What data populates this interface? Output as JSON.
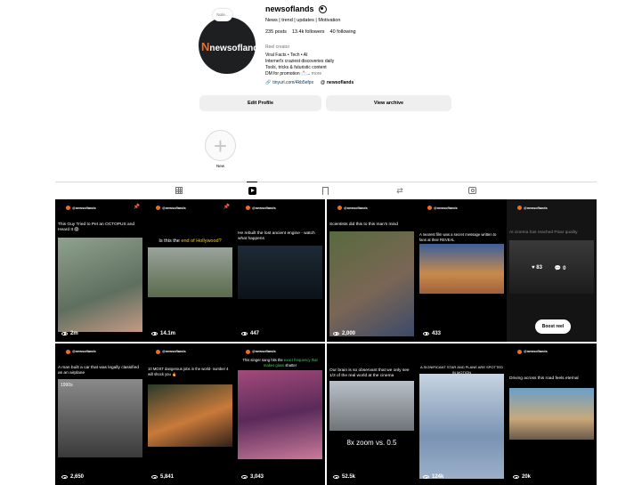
{
  "profile": {
    "note": "Note...",
    "username": "newsoflands",
    "avatar_logo": "newsoflands",
    "avatar_logo_letter": "N",
    "category_line": "News | trend | updates | Motivation",
    "posts": "235 posts",
    "followers": "13.4k followers",
    "following": "40 following",
    "role": "Reel creator",
    "bio_lines": [
      "Viral Facts • Tech • AI",
      "Internet's craziest discoveries daily",
      "Tools, tricks & futuristic content"
    ],
    "bio_last": "DM for promotion 📩...",
    "more": "more",
    "link": "tinyurl.com/4kb5efpx",
    "threads": "newsoflands"
  },
  "buttons": {
    "edit_profile": "Edit Profile",
    "view_archive": "View archive"
  },
  "highlight": {
    "label": "New"
  },
  "tabs": [
    "posts-grid",
    "reels",
    "saved",
    "reposts",
    "tagged"
  ],
  "reel_brand": "@newsoflands",
  "reels": [
    {
      "caption": "This Guy Tried to Pet an OCTOPUS and Heard It 😱",
      "views": "2m",
      "pinned": true
    },
    {
      "caption_pre": "Is this the ",
      "caption_hl": "end of Hollywood?",
      "views": "14.1m",
      "pinned": true
    },
    {
      "caption": "He rebuilt the lost ancient engine - watch what happens",
      "views": "447"
    },
    {
      "caption": "Scientists did this to this man's mind",
      "views": "2,000"
    },
    {
      "caption": "A nearest film was a secret message written to fans at their REVEAL",
      "views": "433"
    },
    {
      "caption": "AI cinema has reached Pixar quality",
      "likes": "83",
      "comments": "0",
      "boost": "Boost reel"
    },
    {
      "caption": "A man built a car that was legally classified as an airplane",
      "overlay": "1990s",
      "views": "2,650"
    },
    {
      "caption": "10 MOST dangerous jobs in the world- number 4 will shock you 🔥",
      "views": "5,841"
    },
    {
      "caption_pre": "This singer sang hits the ",
      "caption_hl": "exact frequency that makes glass",
      "caption_post": " shatter",
      "views": "3,043"
    },
    {
      "caption": "Our brain is so observant that we only see 1/3 of the real world at the cinema",
      "overlay": "8x zoom vs. 0.5",
      "views": "52.5k"
    },
    {
      "caption": "A SIGNIFICANT STAR AND PLANE ARE SPOTTED IN MOTION",
      "views": "124k"
    },
    {
      "caption": "Driving across this road feels eternal",
      "views": "20k"
    }
  ],
  "colors": {
    "brand": "#f36b21",
    "link": "#00376b",
    "muted": "#737373",
    "button_bg": "#efefef"
  }
}
